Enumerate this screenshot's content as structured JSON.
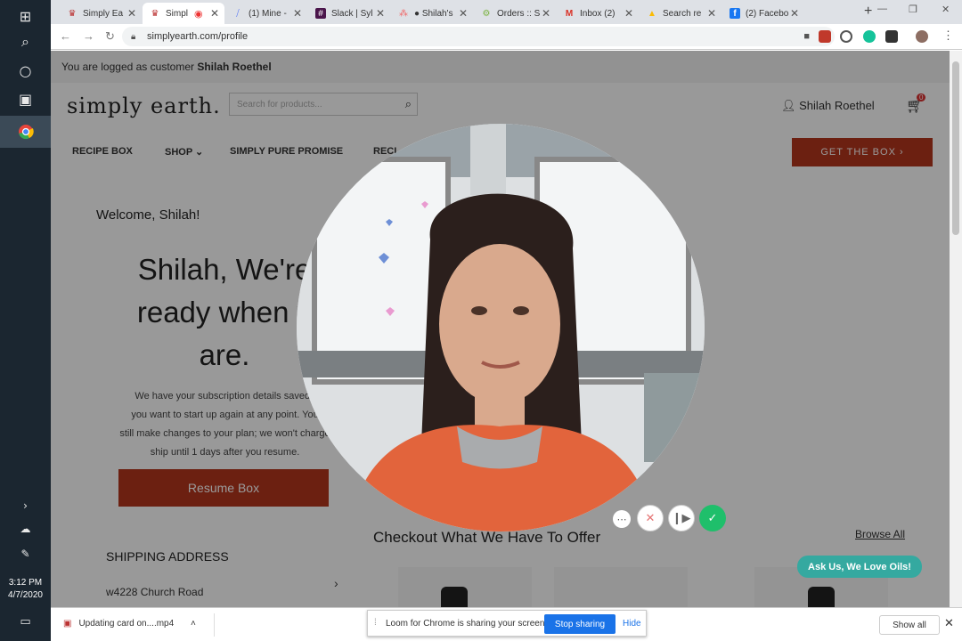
{
  "taskbar": {
    "time": "3:12 PM",
    "date": "4/7/2020",
    "icons": [
      "windows-logo-icon",
      "search-icon",
      "cortana-icon",
      "task-view-icon",
      "chrome-icon"
    ]
  },
  "tabs": [
    {
      "label": "Simply Ea",
      "icon": "simply-earth-favicon"
    },
    {
      "label": "Simpl",
      "icon": "simply-earth-favicon",
      "active": true
    },
    {
      "label": "(1) Mine -",
      "icon": "clickup-icon"
    },
    {
      "label": "Slack | Syl",
      "icon": "slack-icon"
    },
    {
      "label": "● Shilah's",
      "icon": "asana-icon"
    },
    {
      "label": "Orders :: S",
      "icon": "gear-icon"
    },
    {
      "label": "Inbox (2)",
      "icon": "gmail-icon"
    },
    {
      "label": "Search re",
      "icon": "drive-icon"
    },
    {
      "label": "(2) Facebo",
      "icon": "facebook-icon"
    }
  ],
  "address": {
    "url": "simplyearth.com/profile"
  },
  "site": {
    "login_prefix": "You are logged as customer",
    "login_name": "Shilah Roethel",
    "logo": "simply earth.",
    "search_placeholder": "Search for products...",
    "user_name": "Shilah Roethel",
    "cart_count": "0",
    "menu": [
      "RECIPE BOX",
      "SHOP",
      "SIMPLY PURE PROMISE",
      "RECI"
    ],
    "get_box": "GET THE BOX ›",
    "welcome": "Welcome, Shilah!",
    "headline_l1": "Shilah, We're",
    "headline_l2": "ready when y",
    "headline_l3": "are.",
    "sub_l1": "We have your subscription details saved i",
    "sub_l2": "you want to start up again at any point. You",
    "sub_l3": "still make changes to your plan; we won't charge",
    "sub_l4": "ship until 1 days after you resume.",
    "resume": "Resume Box",
    "shipping_head": "SHIPPING ADDRESS",
    "shipping_addr": "w4228 Church Road",
    "checkout": "Checkout What We Have To Offer",
    "browse_all": "Browse All",
    "ask_us": "Ask Us, We Love Oils!"
  },
  "download": {
    "filename": "Updating card on....mp4",
    "loom_msg": "Loom for Chrome is sharing your screen.",
    "stop": "Stop sharing",
    "hide": "Hide",
    "show_all": "Show all"
  }
}
